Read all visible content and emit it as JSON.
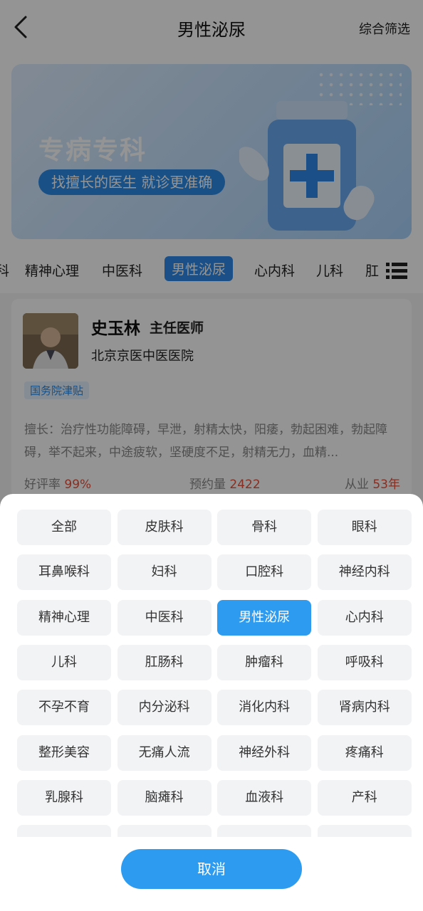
{
  "header": {
    "title": "男性泌尿",
    "filter_label": "综合筛选"
  },
  "banner": {
    "title": "专病专科",
    "subtitle": "找擅长的医生 就诊更准确"
  },
  "dept_tabs": [
    {
      "label": "科"
    },
    {
      "label": "精神心理"
    },
    {
      "label": "中医科"
    },
    {
      "label": "男性泌尿",
      "active": true
    },
    {
      "label": "心内科"
    },
    {
      "label": "儿科"
    },
    {
      "label": "肛"
    }
  ],
  "doctor": {
    "name": "史玉林",
    "title": "主任医师",
    "hospital": "北京京医中医医院",
    "badge": "国务院津贴",
    "skill": "擅长：治疗性功能障碍，早泄，射精太快，阳痿，勃起困难，勃起障碍，举不起来，中途疲软，坚硬度不足，射精无力，血精...",
    "rating_label": "好评率",
    "rating_value": "99%",
    "appointments_label": "预约量",
    "appointments_value": "2422",
    "years_label": "从业",
    "years_value": "53年"
  },
  "sheet": {
    "departments": [
      "全部",
      "皮肤科",
      "骨科",
      "眼科",
      "耳鼻喉科",
      "妇科",
      "口腔科",
      "神经内科",
      "精神心理",
      "中医科",
      "男性泌尿",
      "心内科",
      "儿科",
      "肛肠科",
      "肿瘤科",
      "呼吸科",
      "不孕不育",
      "内分泌科",
      "消化内科",
      "肾病内科",
      "整形美容",
      "无痛人流",
      "神经外科",
      "疼痛科",
      "乳腺科",
      "脑瘫科",
      "血液科",
      "产科",
      "",
      "",
      "",
      ""
    ],
    "selected": "男性泌尿",
    "cancel_label": "取消"
  },
  "colors": {
    "accent": "#2d9bf0",
    "highlight": "#e8513c"
  }
}
